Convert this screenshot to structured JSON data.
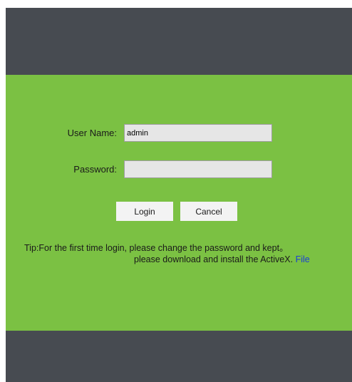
{
  "login": {
    "username_label": "User Name:",
    "username_value": "admin",
    "password_label": "Password:",
    "password_value": "",
    "login_button": "Login",
    "cancel_button": "Cancel"
  },
  "tip": {
    "line1": "Tip:For the first time login, please change the password and kept。",
    "line2": "please download and install the ActiveX.",
    "file_link": "File"
  },
  "colors": {
    "panel": "#7bc143",
    "band": "#474b51",
    "link": "#1a3fd6"
  }
}
